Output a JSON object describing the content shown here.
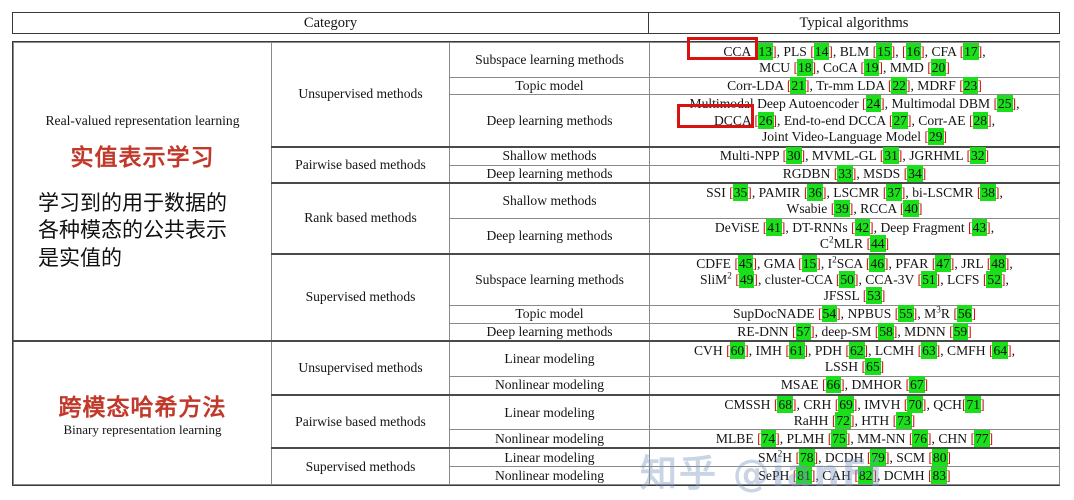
{
  "header": {
    "category_label": "Category",
    "algorithms_label": "Typical algorithms"
  },
  "watermark": {
    "text": "知乎 @ianFi"
  },
  "annotations": {
    "red_box_1_target": "CCA [13]",
    "red_box_2_target": "DCCA [26]",
    "red_color": "#d81111",
    "cite_highlight_color": "#19e019",
    "cn_heading_color": "#c0392b"
  },
  "blocks": [
    {
      "id": "real-valued",
      "title_en": "Real-valued representation learning",
      "title_cn": "实值表示学习",
      "note_cn": "学习到的用于数据的各种模态的公共表示是实值的",
      "groups": [
        {
          "name": "Unsupervised methods",
          "rows": [
            {
              "subtype": "Subspace learning methods",
              "algorithms": "CCA [13], PLS [14], BLM [15], [16], CFA [17], MCU [18], CoCA [19], MMD [20]"
            },
            {
              "subtype": "Topic model",
              "algorithms": "Corr-LDA [21], Tr-mm LDA [22], MDRF [23]"
            },
            {
              "subtype": "Deep learning methods",
              "algorithms": "Multimodal Deep Autoencoder [24], Multimodal DBM [25], DCCA [26], End-to-end DCCA [27], Corr-AE [28], Joint Video-Language Model [29]"
            }
          ]
        },
        {
          "name": "Pairwise based methods",
          "rows": [
            {
              "subtype": "Shallow methods",
              "algorithms": "Multi-NPP [30], MVML-GL [31], JGRHML [32]"
            },
            {
              "subtype": "Deep learning methods",
              "algorithms": "RGDBN [33], MSDS [34]"
            }
          ]
        },
        {
          "name": "Rank based methods",
          "rows": [
            {
              "subtype": "Shallow methods",
              "algorithms": "SSI [35], PAMIR [36], LSCMR [37], bi-LSCMR [38], Wsabie [39], RCCA [40]"
            },
            {
              "subtype": "Deep learning methods",
              "algorithms": "DeViSE [41], DT-RNNs [42], Deep Fragment [43], C2MLR [44]"
            }
          ]
        },
        {
          "name": "Supervised methods",
          "rows": [
            {
              "subtype": "Subspace learning methods",
              "algorithms": "CDFE [45], GMA [15], I2SCA [46], PFAR [47], JRL [48], SliM2 [49], cluster-CCA [50], CCA-3V [51], LCFS [52], JFSSL [53]"
            },
            {
              "subtype": "Topic model",
              "algorithms": "SupDocNADE [54], NPBUS [55], M3R [56]"
            },
            {
              "subtype": "Deep learning methods",
              "algorithms": "RE-DNN [57], deep-SM [58], MDNN [59]"
            }
          ]
        }
      ]
    },
    {
      "id": "cross-modal-hashing",
      "title_en": "Binary representation learning",
      "title_cn": "跨模态哈希方法",
      "groups": [
        {
          "name": "Unsupervised methods",
          "rows": [
            {
              "subtype": "Linear modeling",
              "algorithms": "CVH [60], IMH [61], PDH [62], LCMH [63], CMFH [64], LSSH [65]"
            },
            {
              "subtype": "Nonlinear modeling",
              "algorithms": "MSAE [66], DMHOR [67]"
            }
          ]
        },
        {
          "name": "Pairwise based methods",
          "rows": [
            {
              "subtype": "Linear modeling",
              "algorithms": "CMSSH [68], CRH [69], IMVH [70], QCH[71], RaHH [72], HTH [73]"
            },
            {
              "subtype": "Nonlinear modeling",
              "algorithms": "MLBE [74], PLMH [75], MM-NN [76], CHN [77]"
            }
          ]
        },
        {
          "name": "Supervised methods",
          "rows": [
            {
              "subtype": "Linear modeling",
              "algorithms": "SM2H [78], DCDH [79], SCM [80]"
            },
            {
              "subtype": "Nonlinear modeling",
              "algorithms": "SePH [81], CAH [82], DCMH [83]"
            }
          ]
        }
      ]
    }
  ]
}
